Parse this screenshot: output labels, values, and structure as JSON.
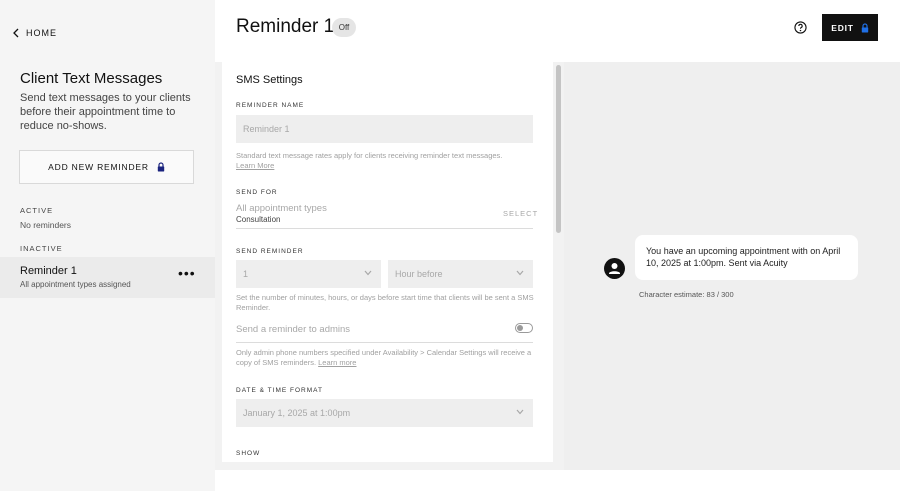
{
  "sidebar": {
    "home_label": "HOME",
    "title": "Client Text Messages",
    "description": "Send text messages to your clients before their appointment time to reduce no-shows.",
    "add_button_label": "ADD NEW REMINDER",
    "active_label": "ACTIVE",
    "active_value": "No reminders",
    "inactive_label": "INACTIVE",
    "reminder": {
      "name": "Reminder 1",
      "subtitle": "All appointment types assigned",
      "more": "•••"
    }
  },
  "header": {
    "title": "Reminder 1",
    "status_badge": "Off",
    "edit_label": "EDIT"
  },
  "settings": {
    "heading": "SMS Settings",
    "reminder_name_label": "REMINDER NAME",
    "reminder_name_value": "Reminder 1",
    "rates_hint": "Standard text message rates apply for clients receiving reminder text messages.",
    "learn_more": "Learn More",
    "send_for_label": "SEND FOR",
    "send_for_placeholder": "All appointment types",
    "send_for_value": "Consultation",
    "select_label": "SELECT",
    "send_reminder_label": "SEND REMINDER",
    "amount_value": "1",
    "unit_value": "Hour before",
    "send_reminder_hint": "Set the number of minutes, hours, or days before start time that clients will be sent a SMS Reminder.",
    "admin_toggle_label": "Send a reminder to admins",
    "admin_toggle_on": false,
    "admin_hint": "Only admin phone numbers specified under Availability > Calendar Settings will receive a copy of SMS reminders.",
    "admin_learn_more": "Learn more",
    "datetime_label": "DATE & TIME FORMAT",
    "datetime_value": "January 1, 2025 at 1:00pm",
    "show_label": "SHOW"
  },
  "preview": {
    "message": "You have an upcoming appointment with on April 10, 2025 at 1:00pm. Sent via Acuity",
    "char_estimate": "Character estimate: 83 / 300"
  },
  "colors": {
    "accent_lock": "#1f6fe5",
    "dark": "#111111",
    "sidebar_bg": "#f5f5f5"
  }
}
